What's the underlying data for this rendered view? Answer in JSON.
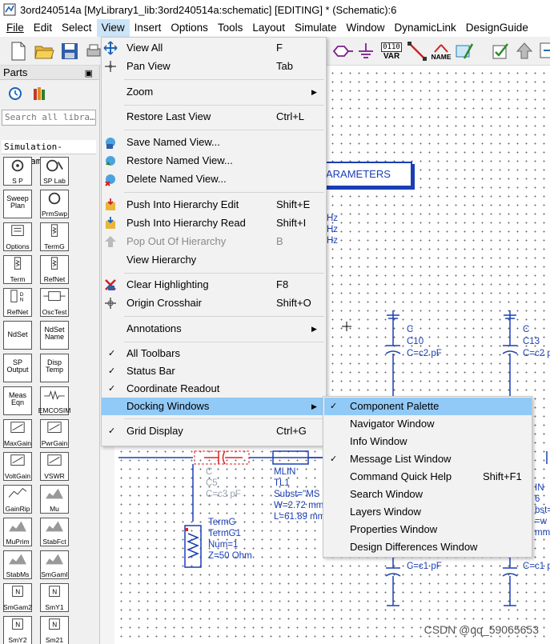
{
  "window": {
    "title": "3ord240514a [MyLibrary1_lib:3ord240514a:schematic] [EDITING] * (Schematic):6"
  },
  "menubar": [
    "File",
    "Edit",
    "Select",
    "View",
    "Insert",
    "Options",
    "Tools",
    "Layout",
    "Simulate",
    "Window",
    "DynamicLink",
    "DesignGuide"
  ],
  "toolbar": {
    "var_label": "VAR",
    "var_top": "0110",
    "name_label": "NAME"
  },
  "parts": {
    "title": "Parts",
    "search_placeholder": "Search all libra…",
    "library": "Simulation-S_Param",
    "items": [
      {
        "glyph": "S P",
        "label": ""
      },
      {
        "glyph": "SP Lab",
        "label": ""
      },
      {
        "glyph": "Sweep Plan",
        "label": ""
      },
      {
        "glyph": "PrmSwp",
        "label": ""
      },
      {
        "glyph": "Options",
        "label": ""
      },
      {
        "glyph": "TermG",
        "label": ""
      },
      {
        "glyph": "Term",
        "label": ""
      },
      {
        "glyph": "RefNet",
        "label": ""
      },
      {
        "glyph": "RefNet",
        "label": ""
      },
      {
        "glyph": "OscTest",
        "label": ""
      },
      {
        "glyph": "NdSet",
        "label": ""
      },
      {
        "glyph": "NdSet Name",
        "label": ""
      },
      {
        "glyph": "SP Output",
        "label": ""
      },
      {
        "glyph": "Disp Temp",
        "label": ""
      },
      {
        "glyph": "Meas Eqn",
        "label": ""
      },
      {
        "glyph": "EMCOSIM",
        "label": ""
      },
      {
        "glyph": "MaxGain",
        "label": ""
      },
      {
        "glyph": "PwrGain",
        "label": ""
      },
      {
        "glyph": "VoltGain",
        "label": ""
      },
      {
        "glyph": "VSWR",
        "label": ""
      },
      {
        "glyph": "GainRip",
        "label": ""
      },
      {
        "glyph": "Mu",
        "label": ""
      },
      {
        "glyph": "MuPrim",
        "label": ""
      },
      {
        "glyph": "StabFct",
        "label": ""
      },
      {
        "glyph": "StabMs",
        "label": ""
      },
      {
        "glyph": "SmGamI",
        "label": ""
      },
      {
        "glyph": "SmGam2",
        "label": ""
      },
      {
        "glyph": "SmY1",
        "label": ""
      },
      {
        "glyph": "SmY2",
        "label": ""
      },
      {
        "glyph": "Sm21",
        "label": ""
      }
    ]
  },
  "view_menu": {
    "items": [
      {
        "label": "View All",
        "shortcut": "F"
      },
      {
        "label": "Pan View",
        "shortcut": "Tab"
      },
      {
        "label": "Zoom",
        "shortcut": ""
      },
      {
        "label": "Restore Last View",
        "shortcut": "Ctrl+L"
      },
      {
        "label": "Save Named View...",
        "shortcut": ""
      },
      {
        "label": "Restore Named View...",
        "shortcut": ""
      },
      {
        "label": "Delete Named View...",
        "shortcut": ""
      },
      {
        "label": "Push Into Hierarchy Edit",
        "shortcut": "Shift+E"
      },
      {
        "label": "Push Into Hierarchy Read",
        "shortcut": "Shift+I"
      },
      {
        "label": "Pop Out Of Hierarchy",
        "shortcut": "B"
      },
      {
        "label": "View Hierarchy",
        "shortcut": ""
      },
      {
        "label": "Clear Highlighting",
        "shortcut": "F8"
      },
      {
        "label": "Origin Crosshair",
        "shortcut": "Shift+O"
      },
      {
        "label": "Annotations",
        "shortcut": ""
      },
      {
        "label": "All Toolbars",
        "shortcut": ""
      },
      {
        "label": "Status Bar",
        "shortcut": ""
      },
      {
        "label": "Coordinate Readout",
        "shortcut": ""
      },
      {
        "label": "Docking Windows",
        "shortcut": ""
      },
      {
        "label": "Grid Display",
        "shortcut": "Ctrl+G"
      }
    ]
  },
  "docking_submenu": {
    "items": [
      {
        "label": "Component Palette",
        "shortcut": "",
        "checked": true
      },
      {
        "label": "Navigator Window",
        "shortcut": "",
        "checked": false
      },
      {
        "label": "Info Window",
        "shortcut": "",
        "checked": false
      },
      {
        "label": "Message List Window",
        "shortcut": "",
        "checked": true
      },
      {
        "label": "Command Quick Help",
        "shortcut": "Shift+F1",
        "checked": false
      },
      {
        "label": "Search Window",
        "shortcut": "",
        "checked": false
      },
      {
        "label": "Layers Window",
        "shortcut": "",
        "checked": false
      },
      {
        "label": "Properties Window",
        "shortcut": "",
        "checked": false
      },
      {
        "label": "Design Differences Window",
        "shortcut": "",
        "checked": false
      }
    ]
  },
  "schematic": {
    "params_title": "ARAMETERS",
    "freq1": "Hz",
    "freq2": "Hz",
    "freq3": "Hz",
    "c10": {
      "type": "C",
      "name": "C10",
      "value": "C=c2 pF"
    },
    "c13": {
      "type": "C",
      "name": "C13",
      "value": "C=c2 p"
    },
    "c5": {
      "type": "C",
      "name": "C5",
      "value": "C=c3 pF"
    },
    "tl1": {
      "type": "MLIN",
      "name": "TL1",
      "subst": "Subst=\"MS",
      "w": "W=2.72 mm",
      "l": "L=61.89 mm"
    },
    "term": {
      "type": "TermG",
      "name": "TermG1",
      "num": "Num=1",
      "z": "Z=50 Ohm"
    },
    "right_frag": {
      "a": "IN",
      "b": "6",
      "c": "bst=",
      "d": "=w",
      "e": "mm"
    },
    "bottom_a": "C=c1 pF",
    "bottom_b": "C=c1 p",
    "bottom_c": "2"
  },
  "watermark": "CSDN @qq_59065653"
}
